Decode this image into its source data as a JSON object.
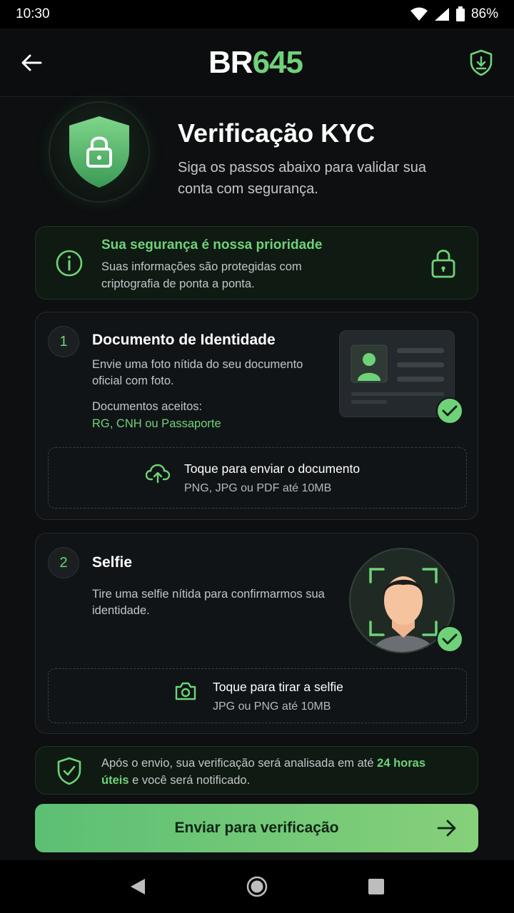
{
  "status_bar": {
    "time": "10:30",
    "battery": "86%"
  },
  "header": {
    "brand_part1": "BR",
    "brand_part2": "645"
  },
  "hero": {
    "title": "Verificação KYC",
    "subtitle": "Siga os passos abaixo para validar sua conta com segurança."
  },
  "security_notice": {
    "title": "Sua segurança é nossa prioridade",
    "text": "Suas informações são protegidas com criptografia de ponta a ponta."
  },
  "steps": [
    {
      "number": "1",
      "title": "Documento de Identidade",
      "description": "Envie uma foto nítida do seu documento oficial com foto.",
      "accepted_label": "Documentos aceitos:",
      "accepted_value": "RG, CNH ou Passaporte",
      "upload_title": "Toque para enviar o documento",
      "upload_sub": "PNG, JPG ou PDF até 10MB"
    },
    {
      "number": "2",
      "title": "Selfie",
      "description": "Tire uma selfie nítida para confirmarmos sua identidade.",
      "upload_title": "Toque para tirar a selfie",
      "upload_sub": "JPG ou PNG até 10MB"
    }
  ],
  "review_note": {
    "text_before": "Após o envio, sua verificação será analisada em até ",
    "highlight": "24 horas úteis",
    "text_after": " e você será notificado."
  },
  "submit_button": {
    "label": "Enviar para verificação"
  },
  "colors": {
    "accent": "#6fd279",
    "background": "#0d0f10",
    "card": "#111416"
  }
}
